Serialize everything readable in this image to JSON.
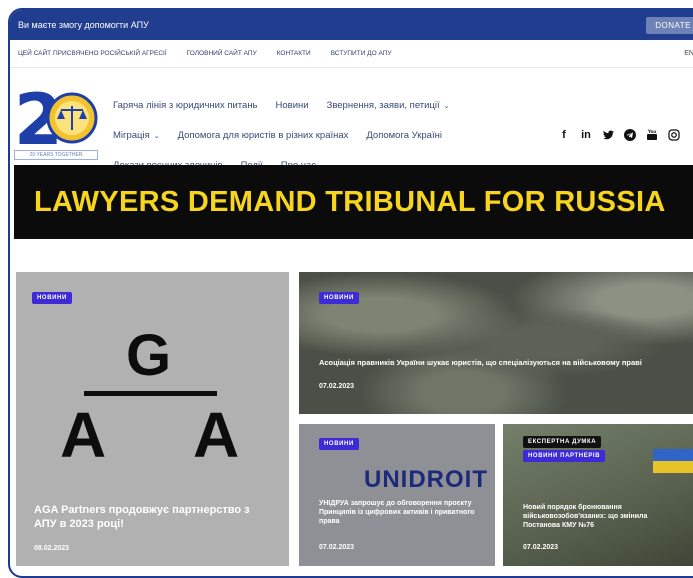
{
  "topbar": {
    "message": "Ви маєте змогу допомогти АПУ",
    "donate_label": "DONATE"
  },
  "linkbar": {
    "items": [
      "ЦЕЙ САЙТ ПРИСВЯЧЕНО РОСІЙСЬКІЙ АГРЕСІЇ",
      "ГОЛОВНИЙ САЙТ АПУ",
      "КОНТАКТИ",
      "ВСТУПИТИ ДО АПУ"
    ],
    "lang": "EN"
  },
  "logo": {
    "caption": "20 YEARS TOGETHER"
  },
  "nav": {
    "row1": [
      "Гаряча лінія з юридичних питань",
      "Новини",
      "Звернення, заяви, петиції"
    ],
    "row2": [
      "Міграція",
      "Допомога для юристів в різних країнах",
      "Допомога Україні"
    ],
    "row3": [
      "Докази воєнних злочинів",
      "Події",
      "Про нас"
    ]
  },
  "socials": [
    "facebook-icon",
    "linkedin-icon",
    "twitter-icon",
    "telegram-icon",
    "youtube-icon",
    "instagram-icon",
    "search-icon"
  ],
  "banner": {
    "text": "LAWYERS DEMAND TRIBUNAL FOR RUSSIA"
  },
  "cards": [
    {
      "badge": "НОВИНИ",
      "title": "AGA Partners продовжує партнерство з АПУ в 2023 році!",
      "date": "08.02.2023",
      "logo_top": "G",
      "logo_left": "A",
      "logo_right": "A"
    },
    {
      "badge": "НОВИНИ",
      "title": "Асоціація правників України шукає юристів, що спеціалізуються на військовому праві",
      "date": "07.02.2023"
    },
    {
      "badge": "НОВИНИ",
      "title": "УНІДРУА запрошує до обговорення проєкту Принципів із цифрових активів і приватного права",
      "date": "07.02.2023",
      "image_text": "UNIDROIT"
    },
    {
      "badge_top": "ЕКСПЕРТНА ДУМКА",
      "badge": "НОВИНИ ПАРТНЕРІВ",
      "title": "Новий порядок бронювання військовозобов'язаних: що змінила Постанова КМУ №76",
      "date": "07.02.2023"
    }
  ],
  "colors": {
    "topbar": "#213d8f",
    "badge": "#3c2bd6",
    "banner_text": "#f7d51f"
  }
}
